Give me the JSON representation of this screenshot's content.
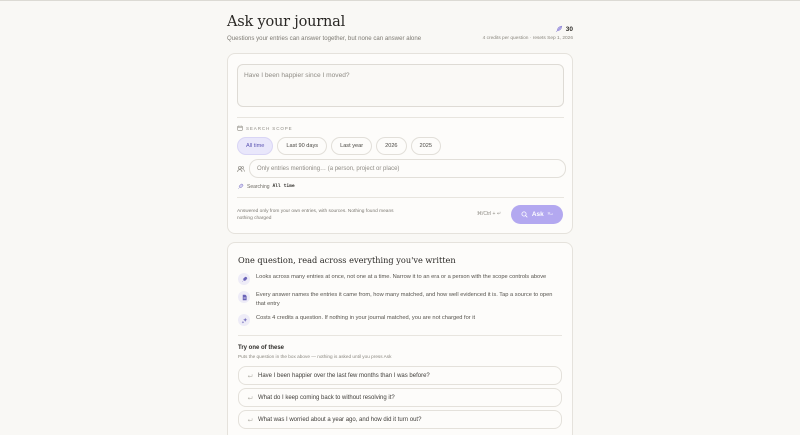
{
  "header": {
    "title": "Ask your journal",
    "subtitle": "Questions your entries can answer together, but none can answer alone",
    "credit_count": "30",
    "cost_note": "4 credits per question · resets Sep 1, 2026"
  },
  "ask_card": {
    "question_placeholder": "Have I been happier since I moved?",
    "scope_label": "SEARCH SCOPE",
    "scope_chips": [
      {
        "label": "All time",
        "active": true
      },
      {
        "label": "Last 90 days",
        "active": false
      },
      {
        "label": "Last year",
        "active": false
      },
      {
        "label": "2026",
        "active": false
      },
      {
        "label": "2025",
        "active": false
      }
    ],
    "person_placeholder": "Only entries mentioning… (a person, project or place)",
    "searching_prefix": "Searching",
    "searching_value": "All time",
    "answered_note": "Answered only from your own entries, with sources. Nothing found means nothing charged",
    "shortcut": "⌘/Ctrl + ↵",
    "ask_label": "Ask",
    "ask_kbd": "⌘↵"
  },
  "info_card": {
    "title": "One question, read across everything you've written",
    "features": [
      {
        "icon": "rocket-icon",
        "text": "Looks across many entries at once, not one at a time. Narrow it to an era or a person with the scope controls above"
      },
      {
        "icon": "document-icon",
        "text": "Every answer names the entries it came from, how many matched, and how well evidenced it is. Tap a source to open that entry"
      },
      {
        "icon": "sparkle-icon",
        "text": "Costs 4 credits a question. If nothing in your journal matched, you are not charged for it"
      }
    ],
    "try_title": "Try one of these",
    "try_subtitle": "Puts the question in the box above — nothing is asked until you press Ask",
    "prompts": [
      "Have I been happier over the last few months than I was before?",
      "What do I keep coming back to without resolving it?",
      "What was I worried about a year ago, and how did it turn out?"
    ]
  },
  "colors": {
    "accent": "#b3a8f0",
    "chip_active_bg": "#e9e7fb",
    "background": "#f9f8f5"
  }
}
